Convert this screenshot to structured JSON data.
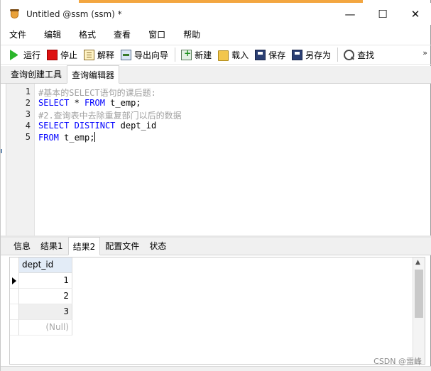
{
  "window": {
    "title": "Untitled @ssm (ssm) *",
    "controls": {
      "minimize": "—",
      "maximize": "☐",
      "close": "✕"
    }
  },
  "menu": [
    "文件",
    "编辑",
    "格式",
    "查看",
    "窗口",
    "帮助"
  ],
  "toolbar": {
    "run": "运行",
    "stop": "停止",
    "explain": "解释",
    "export": "导出向导",
    "new": "新建",
    "load": "载入",
    "save": "保存",
    "save_as": "另存为",
    "find": "查找",
    "more": "»"
  },
  "editor_tabs": [
    "查询创建工具",
    "查询编辑器"
  ],
  "active_editor_tab": "查询编辑器",
  "code_lines": [
    {
      "num": "1",
      "text": "#基本的SELECT语句的课后题:"
    },
    {
      "num": "2",
      "text": "SELECT * FROM t_emp;"
    },
    {
      "num": "3",
      "text": "#2.查询表中去除重复部门以后的数据"
    },
    {
      "num": "4",
      "text": "SELECT DISTINCT dept_id"
    },
    {
      "num": "5",
      "text": "FROM t_emp;"
    }
  ],
  "result_tabs": [
    "信息",
    "结果1",
    "结果2",
    "配置文件",
    "状态"
  ],
  "active_result_tab": "结果2",
  "grid": {
    "column": "dept_id",
    "rows": [
      "1",
      "2",
      "3",
      "(Null)"
    ]
  },
  "watermark": "CSDN @雷峰"
}
